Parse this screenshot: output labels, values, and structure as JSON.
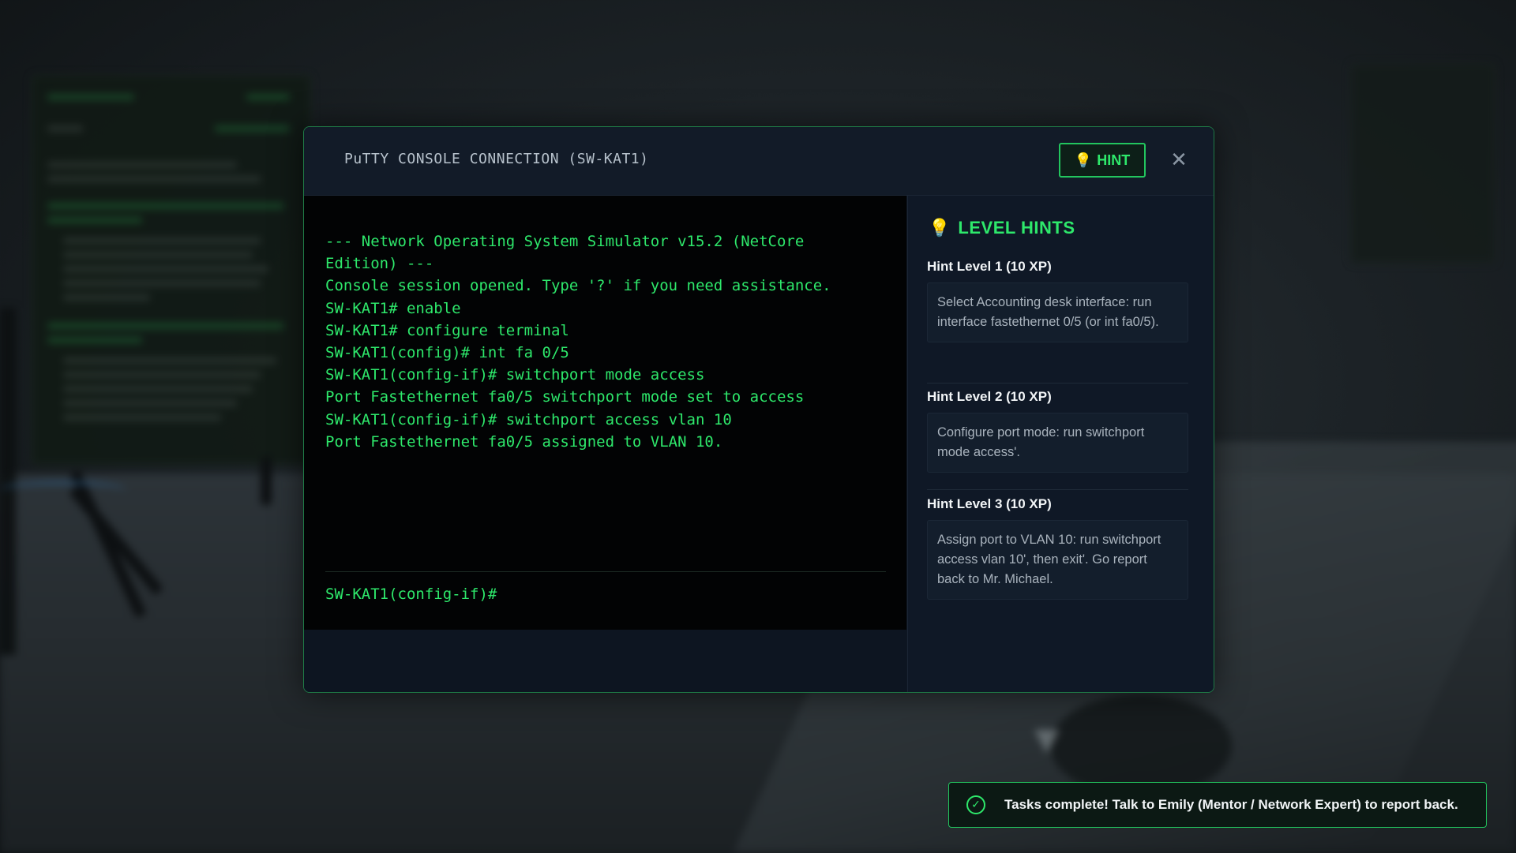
{
  "modal": {
    "title": "PuTTY CONSOLE CONNECTION (SW-KAT1)",
    "hint_button": {
      "icon": "lightbulb-icon",
      "label": "HINT"
    },
    "close_icon": "close-icon",
    "close_glyph": "✕"
  },
  "terminal": {
    "lines": [
      "--- Network Operating System Simulator v15.2 (NetCore Edition) ---",
      "Console session opened. Type '?' if you need assistance.",
      "SW-KAT1# enable",
      "SW-KAT1# configure terminal",
      "SW-KAT1(config)# int fa 0/5",
      "SW-KAT1(config-if)# switchport mode access",
      "Port Fastethernet fa0/5 switchport mode set to access",
      "SW-KAT1(config-if)# switchport access vlan 10",
      "Port Fastethernet fa0/5 assigned to VLAN 10."
    ],
    "prompt": "SW-KAT1(config-if)#",
    "text_color": "#2ee86b"
  },
  "hints": {
    "heading_icon": "lightbulb-icon",
    "heading": "LEVEL HINTS",
    "items": [
      {
        "level": "Hint Level 1 (10 XP)",
        "text": "Select Accounting desk interface: run interface fastethernet 0/5 (or int fa0/5)."
      },
      {
        "level": "Hint Level 2 (10 XP)",
        "text": "Configure port mode: run switchport mode access'."
      },
      {
        "level": "Hint Level 3 (10 XP)",
        "text": "Assign port to VLAN 10: run switchport access vlan 10', then exit'. Go report back to Mr. Michael."
      }
    ]
  },
  "toast": {
    "icon": "check-circle-icon",
    "message": "Tasks complete! Talk to Emily (Mentor / Network Expert) to report back."
  },
  "colors": {
    "accent": "#22c55e",
    "accent_text": "#2ee86b",
    "modal_bg": "#0e1622",
    "terminal_bg": "#020304",
    "bulb": "#f7c948"
  }
}
